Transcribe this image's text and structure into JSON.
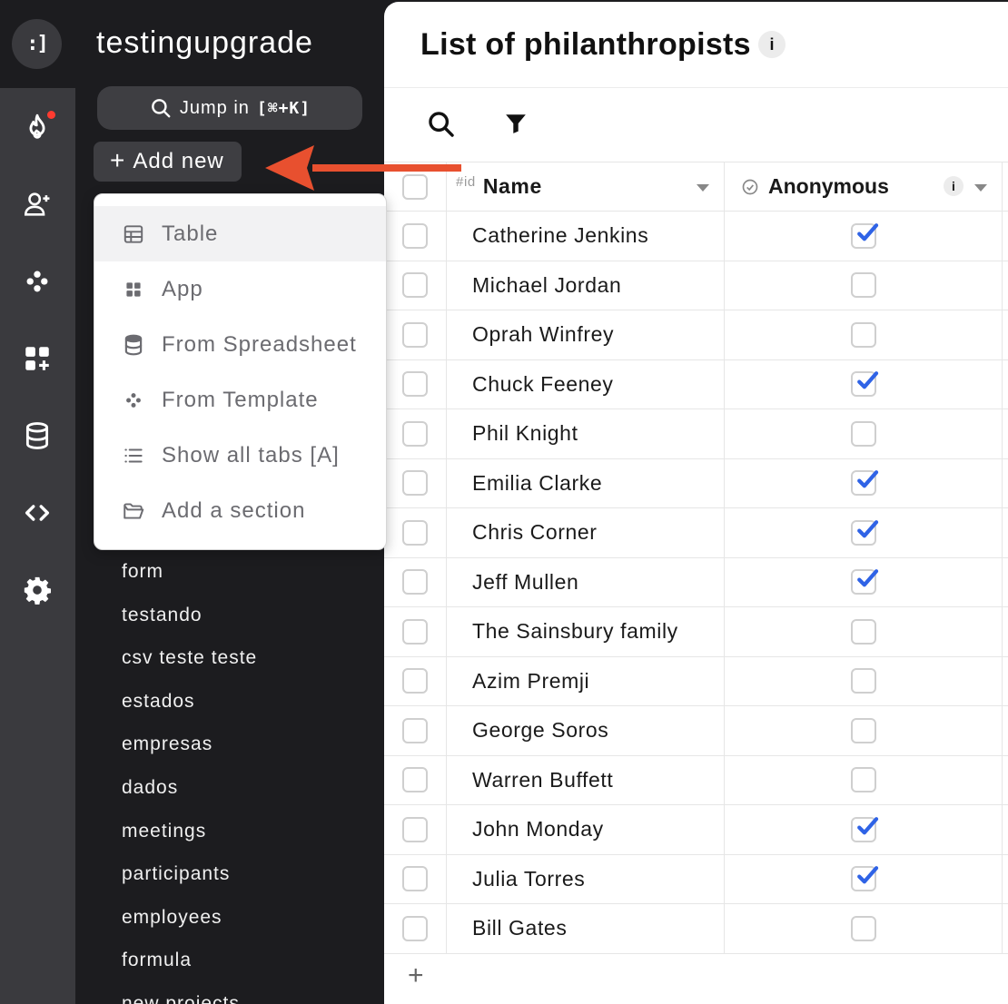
{
  "app": {
    "logo_text": ":]",
    "workspace_title": "testingupgrade"
  },
  "rail": {
    "icons": [
      "fire-icon",
      "add-user-icon",
      "template-dots-icon",
      "add-app-icon",
      "database-icon",
      "code-icon",
      "gear-icon"
    ],
    "notification_color": "#ff3b30"
  },
  "sidebar": {
    "jump_label": "Jump in ",
    "jump_shortcut": "[⌘+K]",
    "add_new_label": "Add new",
    "items": [
      "form",
      "testando",
      "csv teste teste",
      "estados",
      "empresas",
      "dados",
      "meetings",
      "participants",
      "employees",
      "formula",
      "new projects"
    ]
  },
  "menu": {
    "items": [
      {
        "label": "Table",
        "icon": "table-icon"
      },
      {
        "label": "App",
        "icon": "app-grid-icon"
      },
      {
        "label": "From Spreadsheet",
        "icon": "database-icon"
      },
      {
        "label": "From Template",
        "icon": "template-dots-icon"
      },
      {
        "label": "Show all tabs [A]",
        "icon": "list-icon"
      },
      {
        "label": "Add a section",
        "icon": "folder-icon"
      }
    ]
  },
  "annotation": {
    "arrow_color": "#e8502f"
  },
  "main": {
    "title": "List of philanthropists",
    "info_label": "i",
    "columns": {
      "id_tag": "#id",
      "name": "Name",
      "anonymous": "Anonymous",
      "info_label": "i"
    },
    "rows": [
      {
        "name": "Catherine Jenkins",
        "anonymous": true
      },
      {
        "name": "Michael Jordan",
        "anonymous": false
      },
      {
        "name": "Oprah Winfrey",
        "anonymous": false
      },
      {
        "name": "Chuck Feeney",
        "anonymous": true
      },
      {
        "name": "Phil Knight",
        "anonymous": false
      },
      {
        "name": "Emilia Clarke",
        "anonymous": true
      },
      {
        "name": "Chris Corner",
        "anonymous": true
      },
      {
        "name": "Jeff Mullen",
        "anonymous": true
      },
      {
        "name": "The Sainsbury family",
        "anonymous": false
      },
      {
        "name": "Azim Premji",
        "anonymous": false
      },
      {
        "name": "George Soros",
        "anonymous": false
      },
      {
        "name": "Warren Buffett",
        "anonymous": false
      },
      {
        "name": "John Monday",
        "anonymous": true
      },
      {
        "name": "Julia Torres",
        "anonymous": true
      },
      {
        "name": "Bill Gates",
        "anonymous": false
      }
    ],
    "add_row_label": "+",
    "check_color": "#2f63e6"
  }
}
